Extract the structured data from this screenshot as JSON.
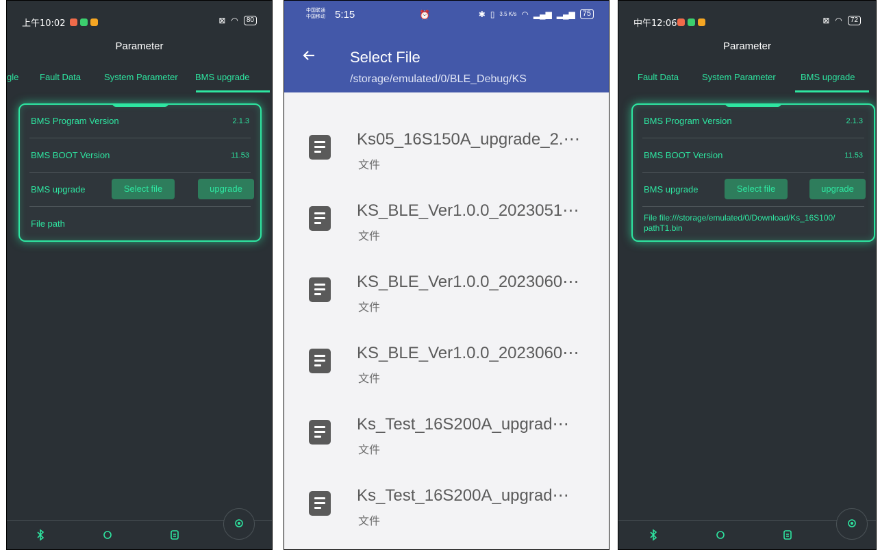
{
  "left": {
    "status": {
      "time": "上午10:02",
      "battery": "80"
    },
    "title": "Parameter",
    "tabs": [
      "gle",
      "Fault Data",
      "System Parameter",
      "BMS upgrade"
    ],
    "rows": {
      "program_label": "BMS Program Version",
      "program_value": "2.1.3",
      "boot_label": "BMS BOOT Version",
      "boot_value": "11.53",
      "upgrade_label": "BMS upgrade",
      "select_btn": "Select file",
      "upgrade_btn": "upgrade",
      "path_label": "File path"
    }
  },
  "middle": {
    "status": {
      "carrier1": "中国联通",
      "carrier2": "中国移动",
      "time": "5:15",
      "speed": "3.5 K/s",
      "battery": "75"
    },
    "title": "Select File",
    "path": "/storage/emulated/0/BLE_Debug/KS",
    "files": [
      {
        "name": "Ks05_16S150A_upgrade_2.⋯",
        "sub": "文件"
      },
      {
        "name": "KS_BLE_Ver1.0.0_2023051⋯",
        "sub": "文件"
      },
      {
        "name": "KS_BLE_Ver1.0.0_2023060⋯",
        "sub": "文件"
      },
      {
        "name": "KS_BLE_Ver1.0.0_2023060⋯",
        "sub": "文件"
      },
      {
        "name": "Ks_Test_16S200A_upgrad⋯",
        "sub": "文件"
      },
      {
        "name": "Ks_Test_16S200A_upgrad⋯",
        "sub": "文件"
      }
    ]
  },
  "right": {
    "status": {
      "time": "中午12:06",
      "battery": "72"
    },
    "title": "Parameter",
    "tabs": [
      "Fault Data",
      "System Parameter",
      "BMS upgrade"
    ],
    "rows": {
      "program_label": "BMS Program Version",
      "program_value": "2.1.3",
      "boot_label": "BMS BOOT Version",
      "boot_value": "11.53",
      "upgrade_label": "BMS upgrade",
      "select_btn": "Select file",
      "upgrade_btn": "upgrade",
      "path_line1": "File  file:///storage/emulated/0/Download/Ks_16S100/",
      "path_line2": "pathT1.bin"
    }
  },
  "colors": {
    "accent": "#2ee6a1",
    "dark_bg": "#2a3035",
    "header_blue": "#4358a9",
    "button_bg": "#2e7d5c"
  }
}
